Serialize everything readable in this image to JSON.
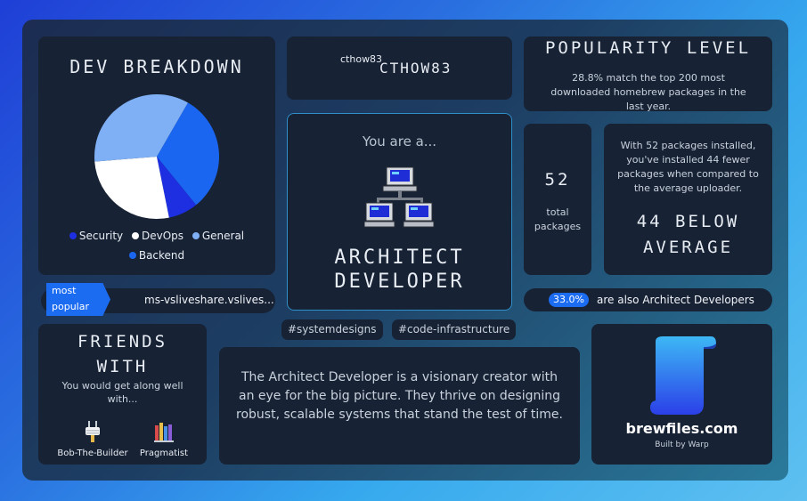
{
  "breakdown": {
    "title": "DEV BREAKDOWN",
    "legend": [
      {
        "label": "Security",
        "color": "#1d2fe0"
      },
      {
        "label": "DevOps",
        "color": "#ffffff"
      },
      {
        "label": "General",
        "color": "#7fb0f5"
      },
      {
        "label": "Backend",
        "color": "#1b66f0"
      }
    ]
  },
  "chart_data": {
    "type": "pie",
    "title": "DEV BREAKDOWN",
    "categories": [
      "Backend",
      "Security",
      "DevOps",
      "General"
    ],
    "values": [
      30.8,
      7.7,
      26.9,
      34.6
    ],
    "colors": [
      "#1b66f0",
      "#1d2fe0",
      "#ffffff",
      "#7fb0f5"
    ]
  },
  "user": {
    "image_alt": "cthow83",
    "name": "CTHOW83"
  },
  "popularity": {
    "title": "POPULARITY LEVEL",
    "text": "28.8% match the top 200 most downloaded homebrew packages in the last year."
  },
  "archetype": {
    "intro": "You are a...",
    "line1": "ARCHITECT",
    "line2": "DEVELOPER",
    "icon": "network-computers-icon"
  },
  "packages": {
    "total": "52",
    "total_label": "total packages",
    "compare_text": "With 52 packages installed, you've installed 44 fewer packages when compared to the average uploader.",
    "below_line1": "44 BELOW",
    "below_line2": "AVERAGE"
  },
  "most_popular": {
    "badge": "most popular",
    "package": "ms-vsliveshare.vslives..."
  },
  "also": {
    "percent": "33.0%",
    "text": "are also Architect Developers"
  },
  "tags": [
    "#systemdesigns",
    "#code-infrastructure"
  ],
  "friends": {
    "title_line1": "FRIENDS",
    "title_line2": "WITH",
    "subtitle": "You would get along well with...",
    "items": [
      {
        "name": "Bob-The-Builder",
        "icon": "power-plug-icon"
      },
      {
        "name": "Pragmatist",
        "icon": "books-icon"
      }
    ]
  },
  "description": "The Architect Developer is a visionary creator with an eye for the big picture. They thrive on designing robust, scalable systems that stand the test of time.",
  "brand": {
    "site": "brewfiles.com",
    "by": "Built by Warp"
  }
}
